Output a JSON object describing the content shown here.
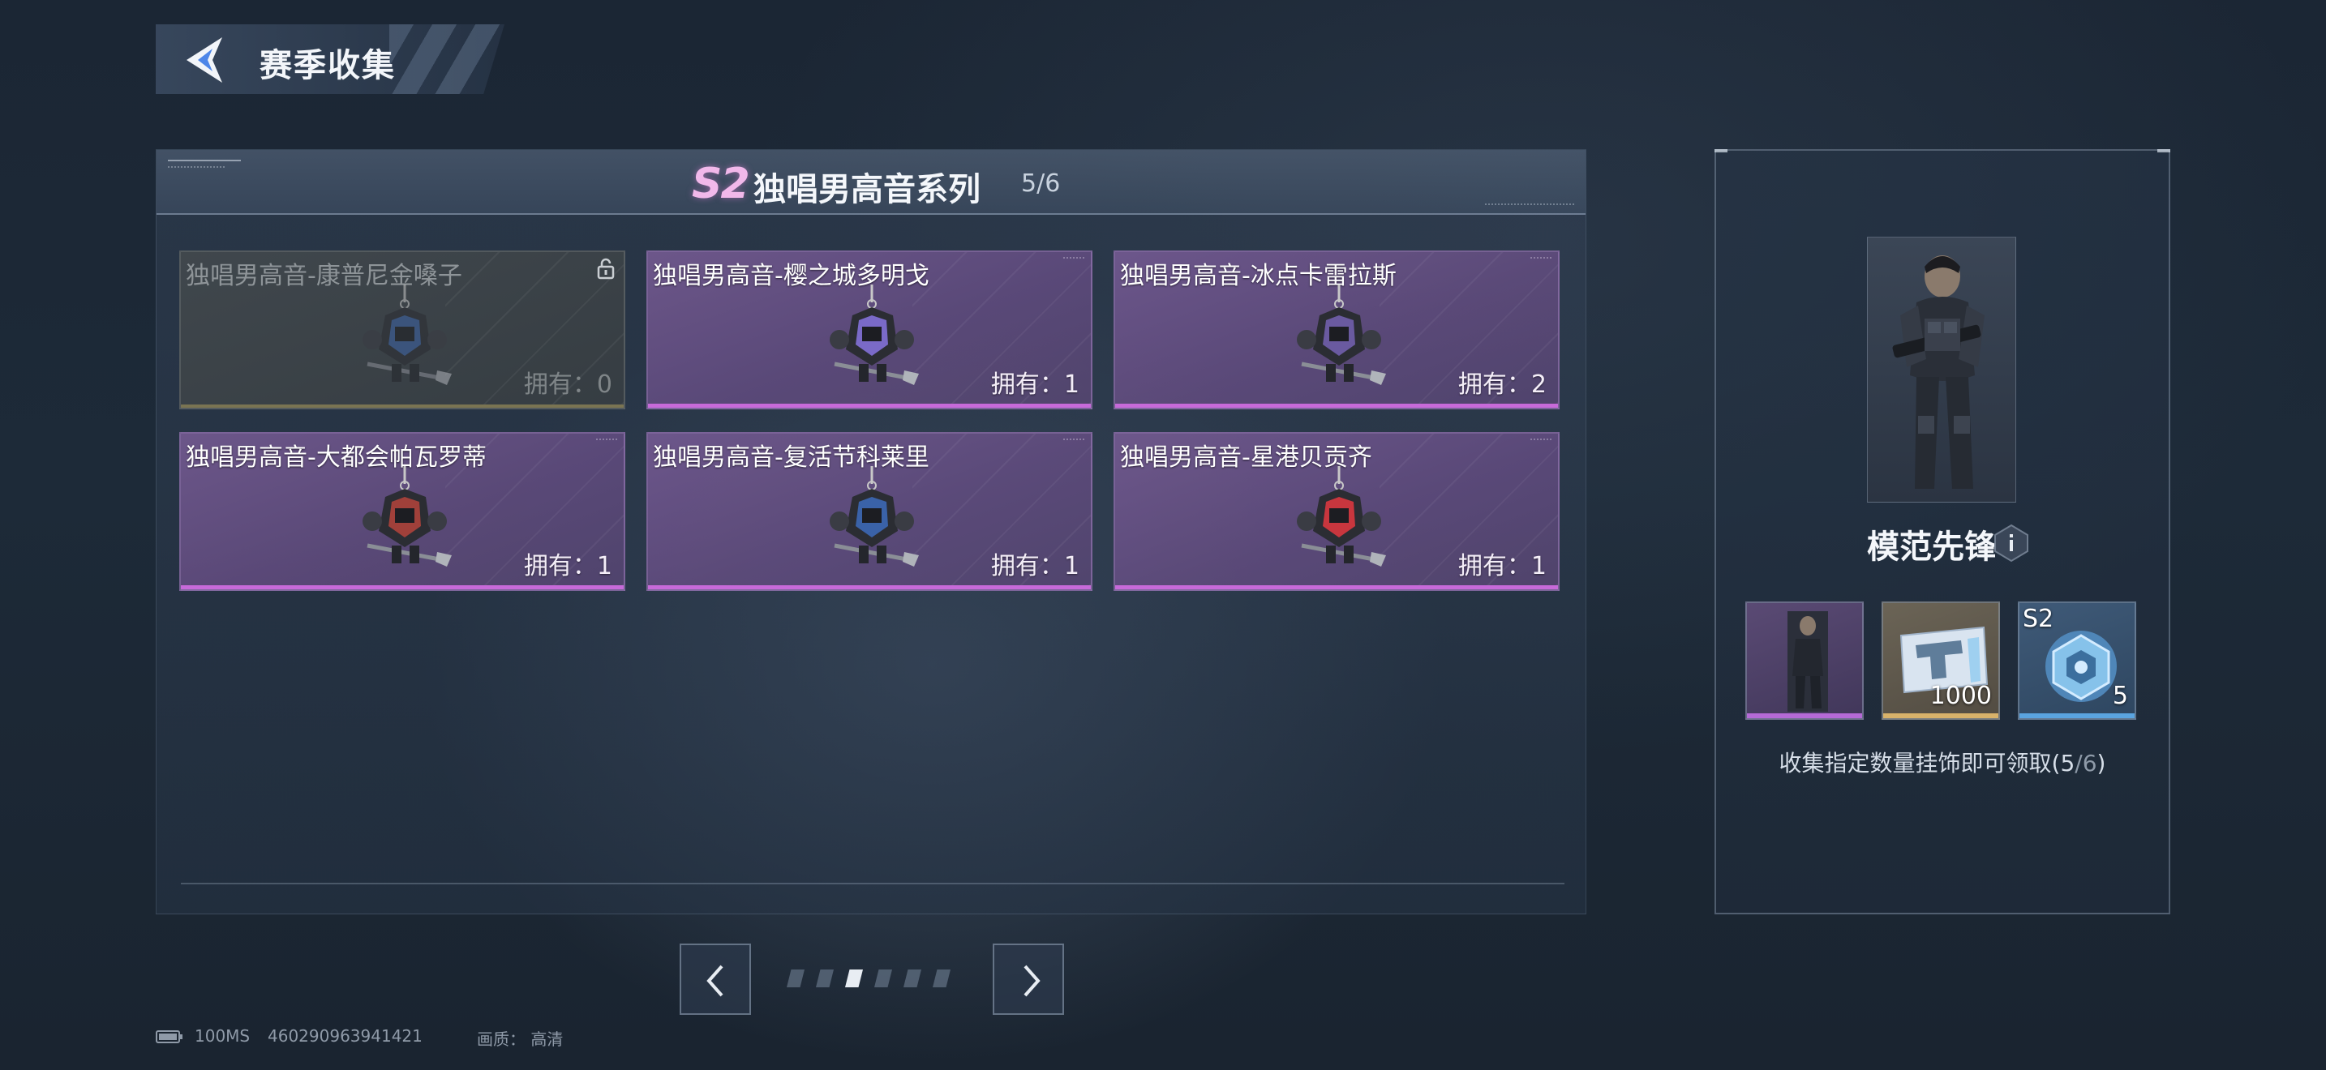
{
  "header": {
    "title": "赛季收集"
  },
  "series": {
    "badge": "S2",
    "title": "独唱男高音系列",
    "progress": "5/6"
  },
  "cards": [
    {
      "name": "独唱男高音-康普尼金嗓子",
      "count": "拥有：0",
      "locked": true,
      "accent": "#3c64a8"
    },
    {
      "name": "独唱男高音-樱之城多明戈",
      "count": "拥有：1",
      "locked": false,
      "accent": "#7a6ac8"
    },
    {
      "name": "独唱男高音-冰点卡雷拉斯",
      "count": "拥有：2",
      "locked": false,
      "accent": "#6a5aa0"
    },
    {
      "name": "独唱男高音-大都会帕瓦罗蒂",
      "count": "拥有：1",
      "locked": false,
      "accent": "#a0403a"
    },
    {
      "name": "独唱男高音-复活节科莱里",
      "count": "拥有：1",
      "locked": false,
      "accent": "#3a62a8"
    },
    {
      "name": "独唱男高音-星港贝贡齐",
      "count": "拥有：1",
      "locked": false,
      "accent": "#c8363e"
    }
  ],
  "pagination": {
    "total": 6,
    "active_index": 2
  },
  "reward": {
    "name": "模范先锋",
    "slots": [
      {
        "type": "character",
        "qty": ""
      },
      {
        "type": "coupon",
        "qty": "1000"
      },
      {
        "type": "crate",
        "qty": "5",
        "season": "S2"
      }
    ],
    "desc_prefix": "收集指定数量挂饰即可领取(",
    "desc_current": "5",
    "desc_sep": "/",
    "desc_total": "6",
    "desc_suffix": ")"
  },
  "status": {
    "ping": "100MS",
    "uid": "460290963941421",
    "quality": "画质： 高清"
  },
  "colors": {
    "card_purple": "#6e5590",
    "card_bar": "#c76ad9",
    "season_pink": "#f1b8ea"
  }
}
